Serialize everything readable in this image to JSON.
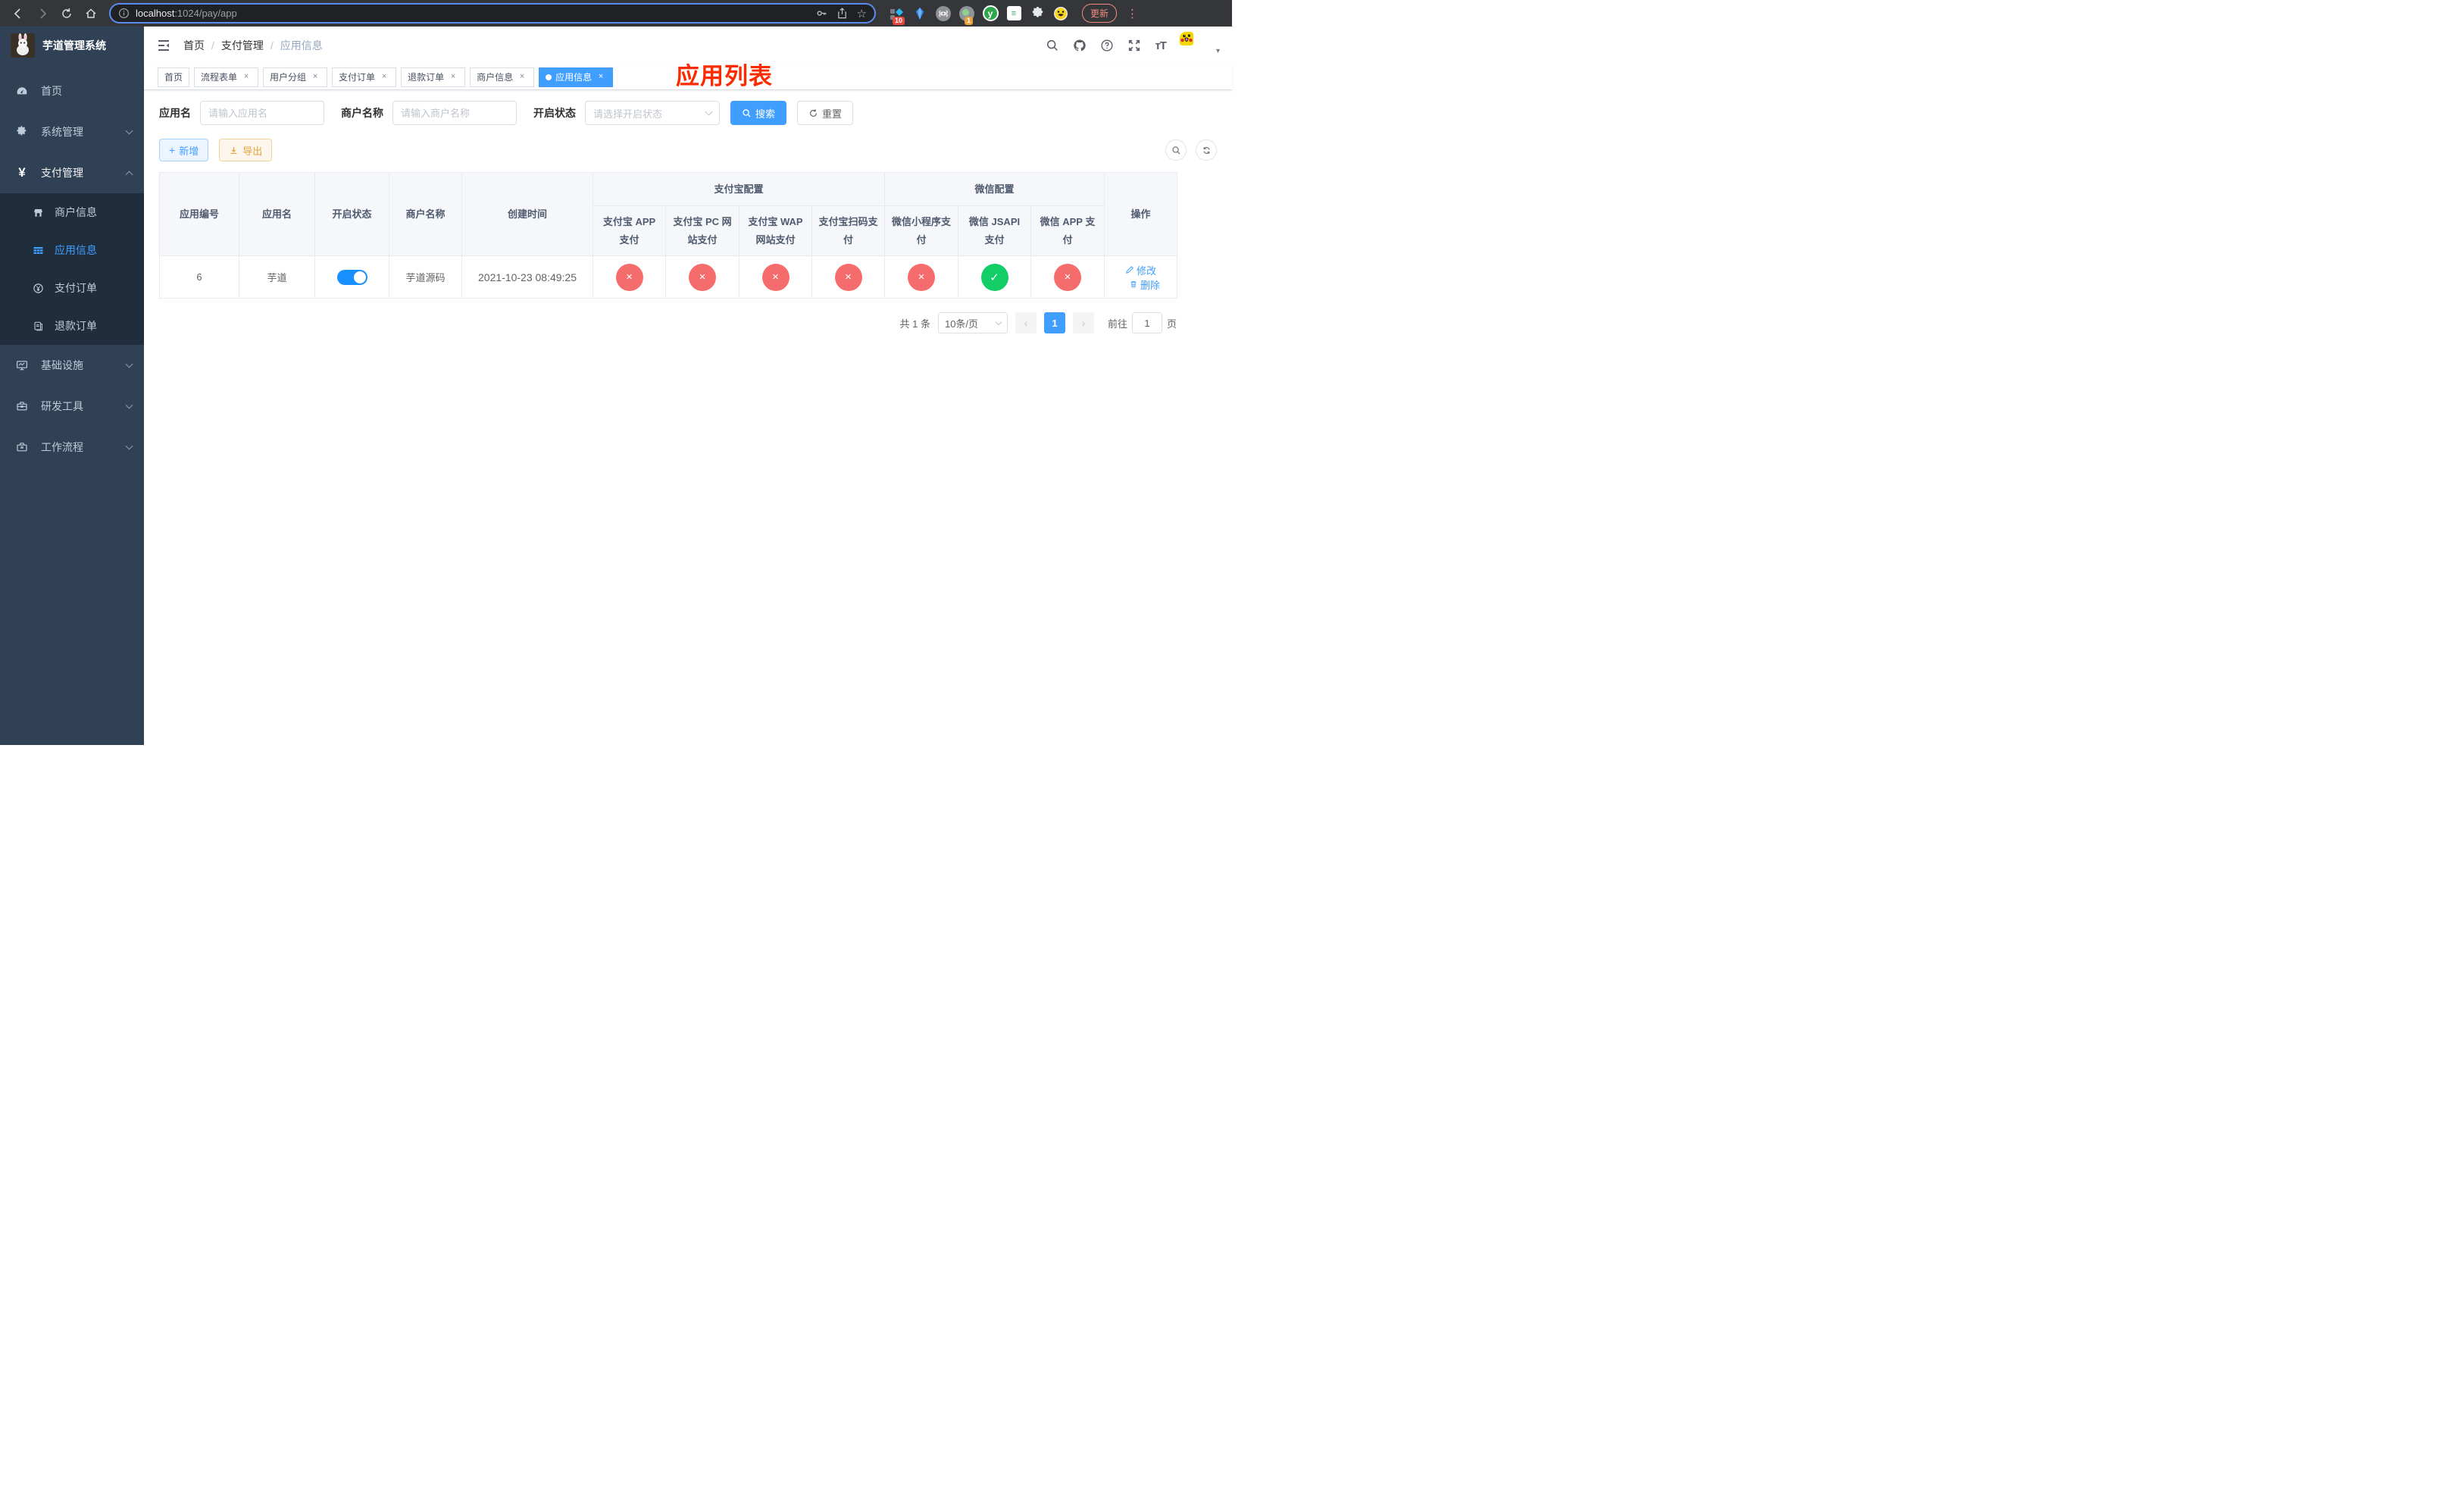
{
  "browser": {
    "url_host": "localhost",
    "url_rest": ":1024/pay/app",
    "ext_badge_grid": "10",
    "ext_badge_dot": "1",
    "ext_letter": "y",
    "update_label": "更新"
  },
  "annotation": {
    "title": "应用列表",
    "color": "#fb2b00"
  },
  "sidebar": {
    "title": "芋道管理系统",
    "home": "首页",
    "system": "系统管理",
    "payment": "支付管理",
    "submenu": [
      {
        "label": "商户信息"
      },
      {
        "label": "应用信息"
      },
      {
        "label": "支付订单"
      },
      {
        "label": "退款订单"
      }
    ],
    "infra": "基础设施",
    "devtools": "研发工具",
    "workflow": "工作流程"
  },
  "breadcrumb": {
    "items": [
      "首页",
      "支付管理",
      "应用信息"
    ]
  },
  "tabs": [
    {
      "label": "首页"
    },
    {
      "label": "流程表单"
    },
    {
      "label": "用户分组"
    },
    {
      "label": "支付订单"
    },
    {
      "label": "退款订单"
    },
    {
      "label": "商户信息"
    },
    {
      "label": "应用信息"
    }
  ],
  "filters": {
    "app_name_label": "应用名",
    "app_name_placeholder": "请输入应用名",
    "merchant_label": "商户名称",
    "merchant_placeholder": "请输入商户名称",
    "status_label": "开启状态",
    "status_placeholder": "请选择开启状态",
    "search_label": "搜索",
    "reset_label": "重置"
  },
  "toolbar": {
    "add_label": "新增",
    "export_label": "导出"
  },
  "table": {
    "columns": {
      "id": "应用编号",
      "name": "应用名",
      "status": "开启状态",
      "merchant": "商户名称",
      "created": "创建时间",
      "alipay_group": "支付宝配置",
      "wechat_group": "微信配置",
      "alipay_cols": [
        "支付宝 APP 支付",
        "支付宝 PC 网站支付",
        "支付宝 WAP 网站支付",
        "支付宝扫码支付"
      ],
      "wechat_cols": [
        "微信小程序支付",
        "微信 JSAPI 支付",
        "微信 APP 支付"
      ],
      "op": "操作"
    },
    "rows": [
      {
        "id": "6",
        "name": "芋道",
        "enabled": true,
        "merchant": "芋道源码",
        "created": "2021-10-23 08:49:25",
        "channels": [
          "fail",
          "fail",
          "fail",
          "fail",
          "fail",
          "success",
          "fail"
        ],
        "edit_label": "修改",
        "delete_label": "删除"
      }
    ]
  },
  "pagination": {
    "total": "共 1 条",
    "page_size": "10条/页",
    "page": "1",
    "goto_prefix": "前往",
    "goto_value": "1",
    "goto_suffix": "页"
  },
  "colors": {
    "accent": "#409eff",
    "danger": "#f56c6c",
    "success": "#13ce66",
    "switch_on": "#1890ff"
  }
}
